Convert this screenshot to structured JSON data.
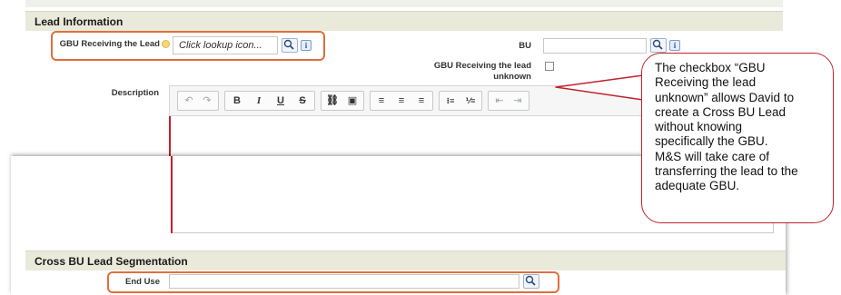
{
  "lead_information": {
    "section_title": "Lead Information",
    "gbu_label": "GBU Receiving the Lead",
    "gbu_placeholder": "Click lookup icon...",
    "bu_label": "BU",
    "gbu_unknown_label_line1": "GBU Receiving the lead",
    "gbu_unknown_label_line2": "unknown",
    "description_label": "Description"
  },
  "editor_toolbar": {
    "undo": "↶",
    "redo": "↷",
    "bold": "B",
    "italic": "I",
    "underline": "U",
    "strike": "S",
    "link": "⛓",
    "image": "▣",
    "align_left": "≡",
    "align_center": "≡",
    "align_right": "≡",
    "bullets": "⁝≡",
    "numbers": "⅟≡",
    "outdent": "⇤",
    "indent": "⇥"
  },
  "cross_bu": {
    "section_title": "Cross BU Lead Segmentation",
    "end_use_label": "End Use"
  },
  "callout": {
    "lines": [
      "The checkbox “GBU",
      "Receiving the lead",
      "unknown” allows David to",
      "create a Cross BU Lead",
      "without knowing",
      "specifically the GBU.",
      "M&S will take care of",
      "transferring the lead to the",
      "adequate GBU."
    ]
  },
  "icons": {
    "lookup": "search-icon",
    "info": "i",
    "colors": {
      "highlight": "#e26d3d",
      "callout_border": "#c0222b",
      "section_bg": "#eaeadb"
    }
  }
}
